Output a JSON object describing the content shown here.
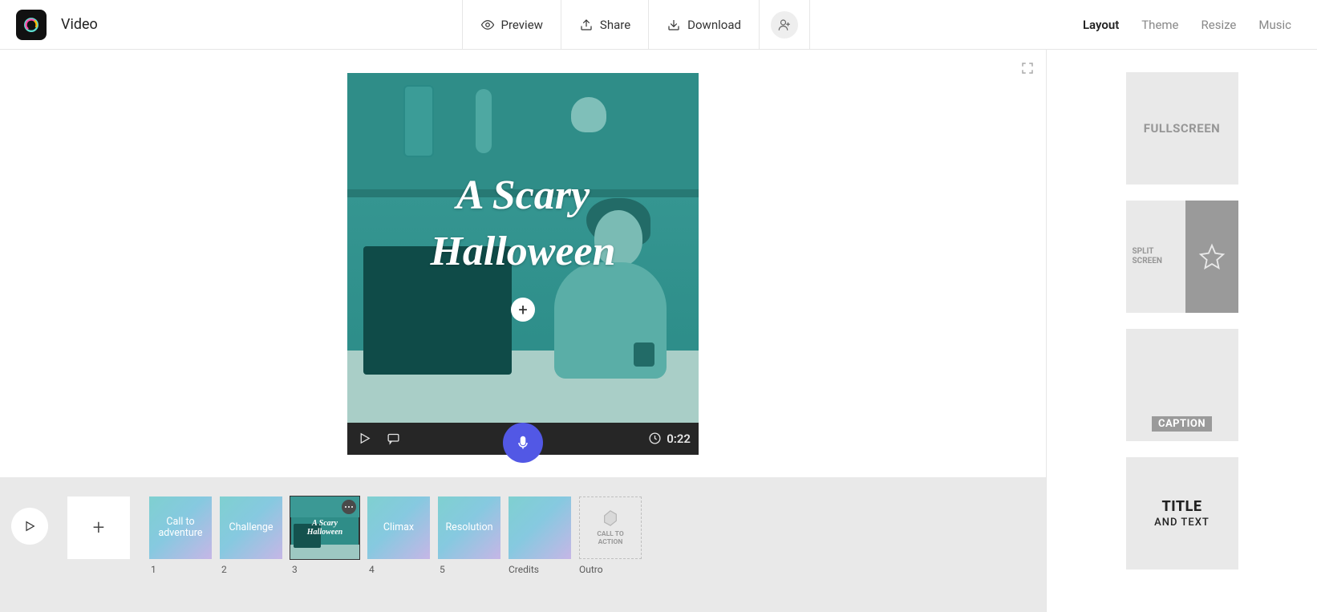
{
  "header": {
    "title": "Video",
    "preview": "Preview",
    "share": "Share",
    "download": "Download"
  },
  "tabs": {
    "layout": "Layout",
    "theme": "Theme",
    "resize": "Resize",
    "music": "Music"
  },
  "video": {
    "title_line1": "A Scary",
    "title_line2": "Halloween",
    "duration": "0:22"
  },
  "layouts": {
    "fullscreen": "FULLSCREEN",
    "split_line1": "SPLIT",
    "split_line2": "SCREEN",
    "caption": "CAPTION",
    "title_line1": "TITLE",
    "title_line2": "AND TEXT"
  },
  "timeline": {
    "clips": [
      {
        "label": "Call to\nadventure",
        "num": "1"
      },
      {
        "label": "Challenge",
        "num": "2"
      },
      {
        "label": "A Scary\nHalloween",
        "num": "3",
        "selected": true,
        "isImg": true
      },
      {
        "label": "Climax",
        "num": "4"
      },
      {
        "label": "Resolution",
        "num": "5"
      },
      {
        "label": "",
        "num": "Credits"
      },
      {
        "label": "CALL TO\nACTION",
        "num": "Outro",
        "empty": true
      }
    ]
  }
}
